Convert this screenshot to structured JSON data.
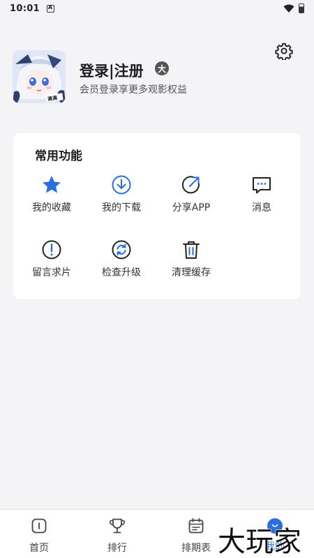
{
  "status_bar": {
    "time": "10:01"
  },
  "profile": {
    "title": "登录|注册",
    "vip_badge": "大",
    "subtitle": "会员登录享更多观影权益",
    "avatar_caption": "滴滴"
  },
  "functions": {
    "title": "常用功能",
    "items": [
      {
        "label": "我的收藏",
        "icon": "star-icon"
      },
      {
        "label": "我的下载",
        "icon": "download-icon"
      },
      {
        "label": "分享APP",
        "icon": "share-icon"
      },
      {
        "label": "消息",
        "icon": "message-icon"
      },
      {
        "label": "留言求片",
        "icon": "exclamation-icon"
      },
      {
        "label": "检查升级",
        "icon": "refresh-icon"
      },
      {
        "label": "清理缓存",
        "icon": "trash-icon"
      }
    ]
  },
  "tab_bar": {
    "tabs": [
      {
        "label": "首页",
        "icon": "home-icon"
      },
      {
        "label": "排行",
        "icon": "trophy-icon"
      },
      {
        "label": "排期表",
        "icon": "calendar-icon"
      },
      {
        "label": "我的",
        "icon": "profile-icon"
      }
    ],
    "active_index": 3
  },
  "watermark": "大玩家",
  "colors": {
    "accent": "#2a6fe0",
    "background": "#f4f4f6",
    "card": "#ffffff"
  }
}
